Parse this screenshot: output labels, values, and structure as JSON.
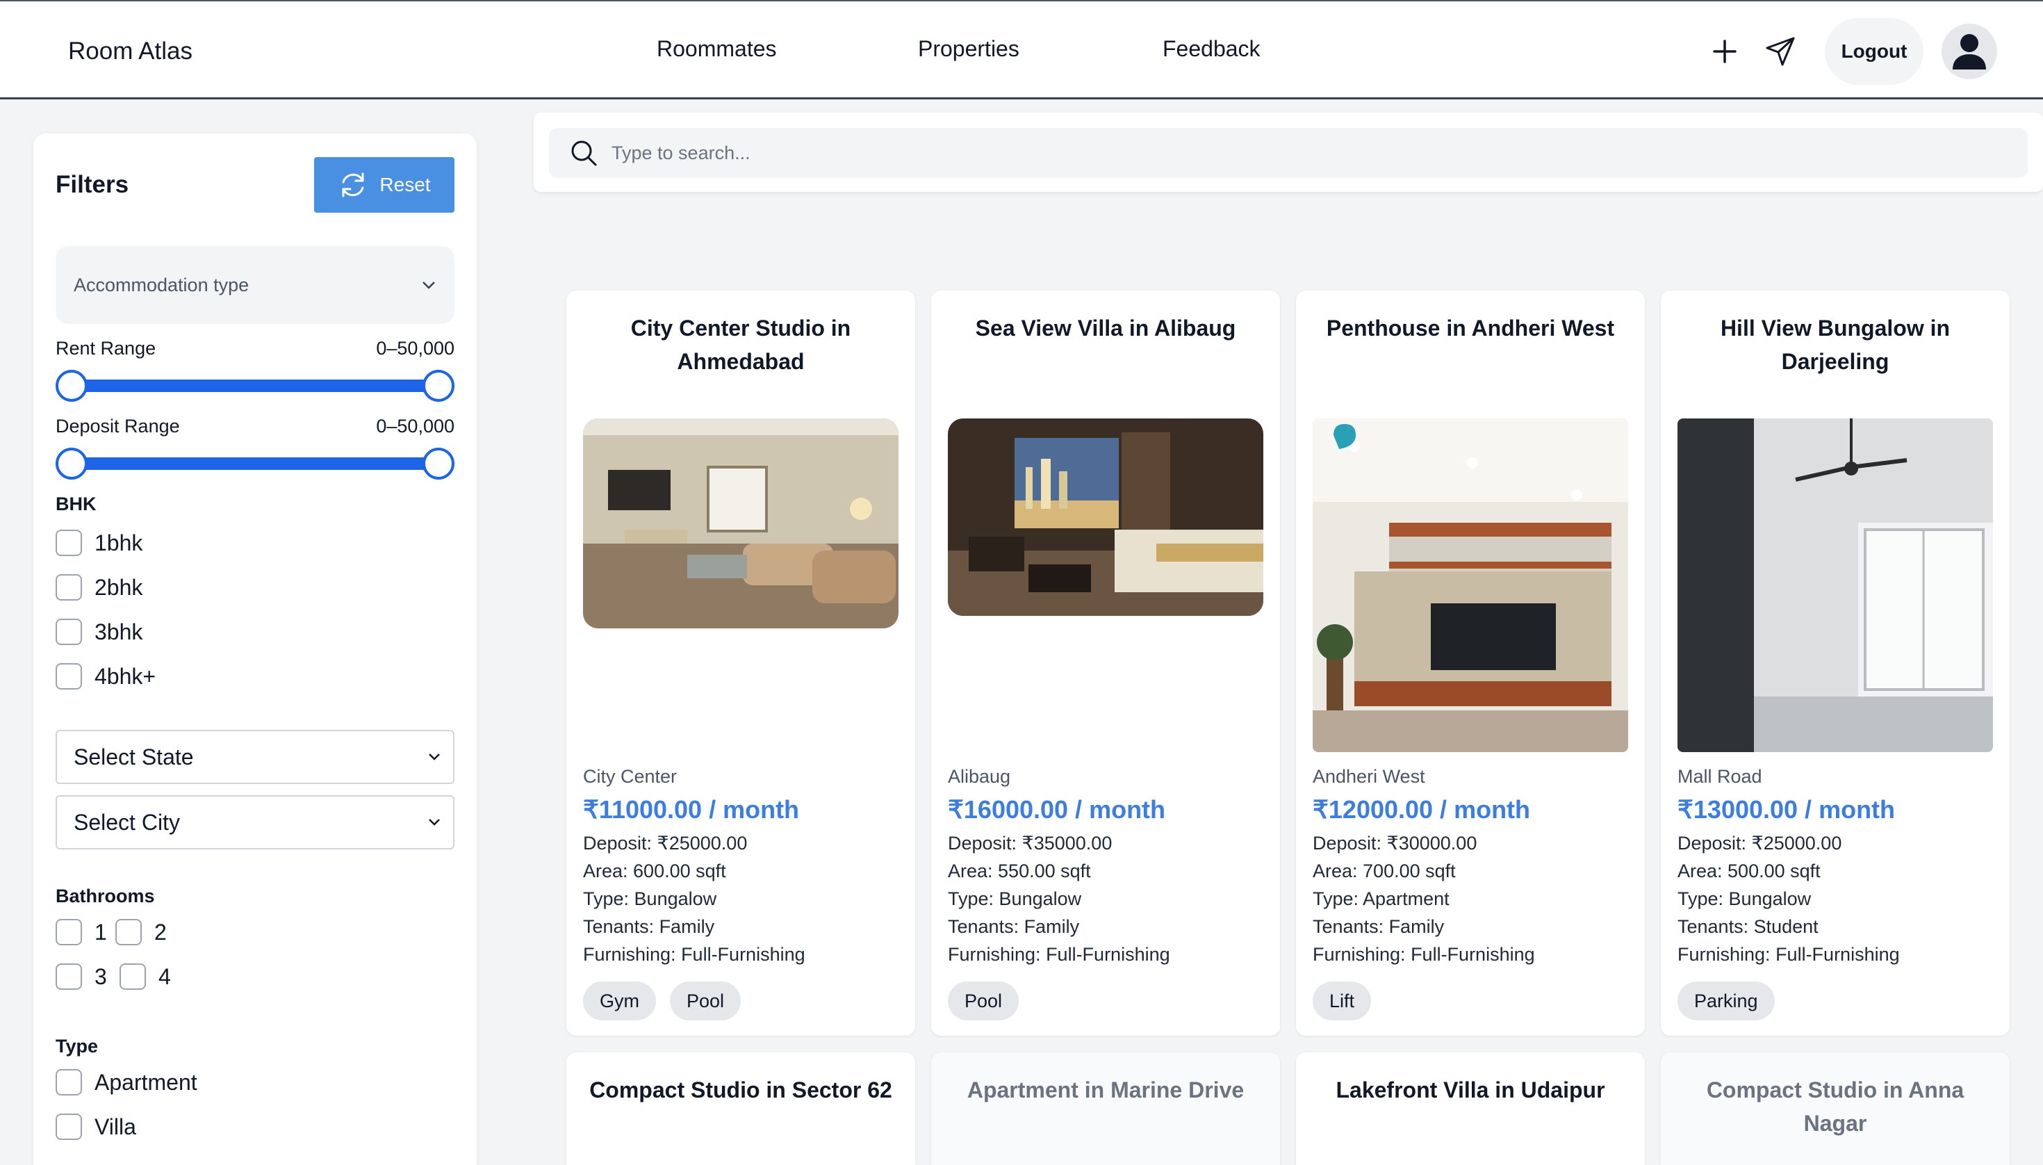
{
  "header": {
    "brand": "Room Atlas",
    "nav": [
      "Roommates",
      "Properties",
      "Feedback"
    ],
    "logout_label": "Logout",
    "icons": [
      "plus-icon",
      "send-icon",
      "user-icon"
    ]
  },
  "filters": {
    "title": "Filters",
    "reset_label": "Reset",
    "accommodation_placeholder": "Accommodation type",
    "rent_label": "Rent Range",
    "rent_value": "0–50,000",
    "deposit_label": "Deposit Range",
    "deposit_value": "0–50,000",
    "bhk_title": "BHK",
    "bhk_options": [
      "1bhk",
      "2bhk",
      "3bhk",
      "4bhk+"
    ],
    "state_select": "Select State",
    "city_select": "Select City",
    "bathrooms_title": "Bathrooms",
    "bathroom_options": [
      "1",
      "2",
      "3",
      "4"
    ],
    "type_title": "Type",
    "type_options": [
      "Apartment",
      "Villa"
    ]
  },
  "search": {
    "placeholder": "Type to search..."
  },
  "colors": {
    "accent": "#1d64e6",
    "price": "#3b7de0",
    "reset_button": "#4a90e2"
  },
  "listings": [
    {
      "title": "City Center Studio in Ahmedabad",
      "location": "City Center",
      "price": "₹11000.00 / month",
      "deposit": "Deposit: ₹25000.00",
      "area": "Area: 600.00 sqft",
      "type": "Type: Bungalow",
      "tenants": "Tenants: Family",
      "furnishing": "Furnishing: Full-Furnishing",
      "tags": [
        "Gym",
        "Pool"
      ]
    },
    {
      "title": "Sea View Villa in Alibaug",
      "location": "Alibaug",
      "price": "₹16000.00 / month",
      "deposit": "Deposit: ₹35000.00",
      "area": "Area: 550.00 sqft",
      "type": "Type: Bungalow",
      "tenants": "Tenants: Family",
      "furnishing": "Furnishing: Full-Furnishing",
      "tags": [
        "Pool"
      ]
    },
    {
      "title": "Penthouse in Andheri West",
      "location": "Andheri West",
      "price": "₹12000.00 / month",
      "deposit": "Deposit: ₹30000.00",
      "area": "Area: 700.00 sqft",
      "type": "Type: Apartment",
      "tenants": "Tenants: Family",
      "furnishing": "Furnishing: Full-Furnishing",
      "tags": [
        "Lift"
      ]
    },
    {
      "title": "Hill View Bungalow in Darjeeling",
      "location": "Mall Road",
      "price": "₹13000.00 / month",
      "deposit": "Deposit: ₹25000.00",
      "area": "Area: 500.00 sqft",
      "type": "Type: Bungalow",
      "tenants": "Tenants: Student",
      "furnishing": "Furnishing: Full-Furnishing",
      "tags": [
        "Parking"
      ]
    }
  ],
  "listings_row2": [
    "Compact Studio in Sector 62",
    "Apartment in Marine Drive",
    "Lakefront Villa in Udaipur",
    "Compact Studio in Anna Nagar"
  ]
}
